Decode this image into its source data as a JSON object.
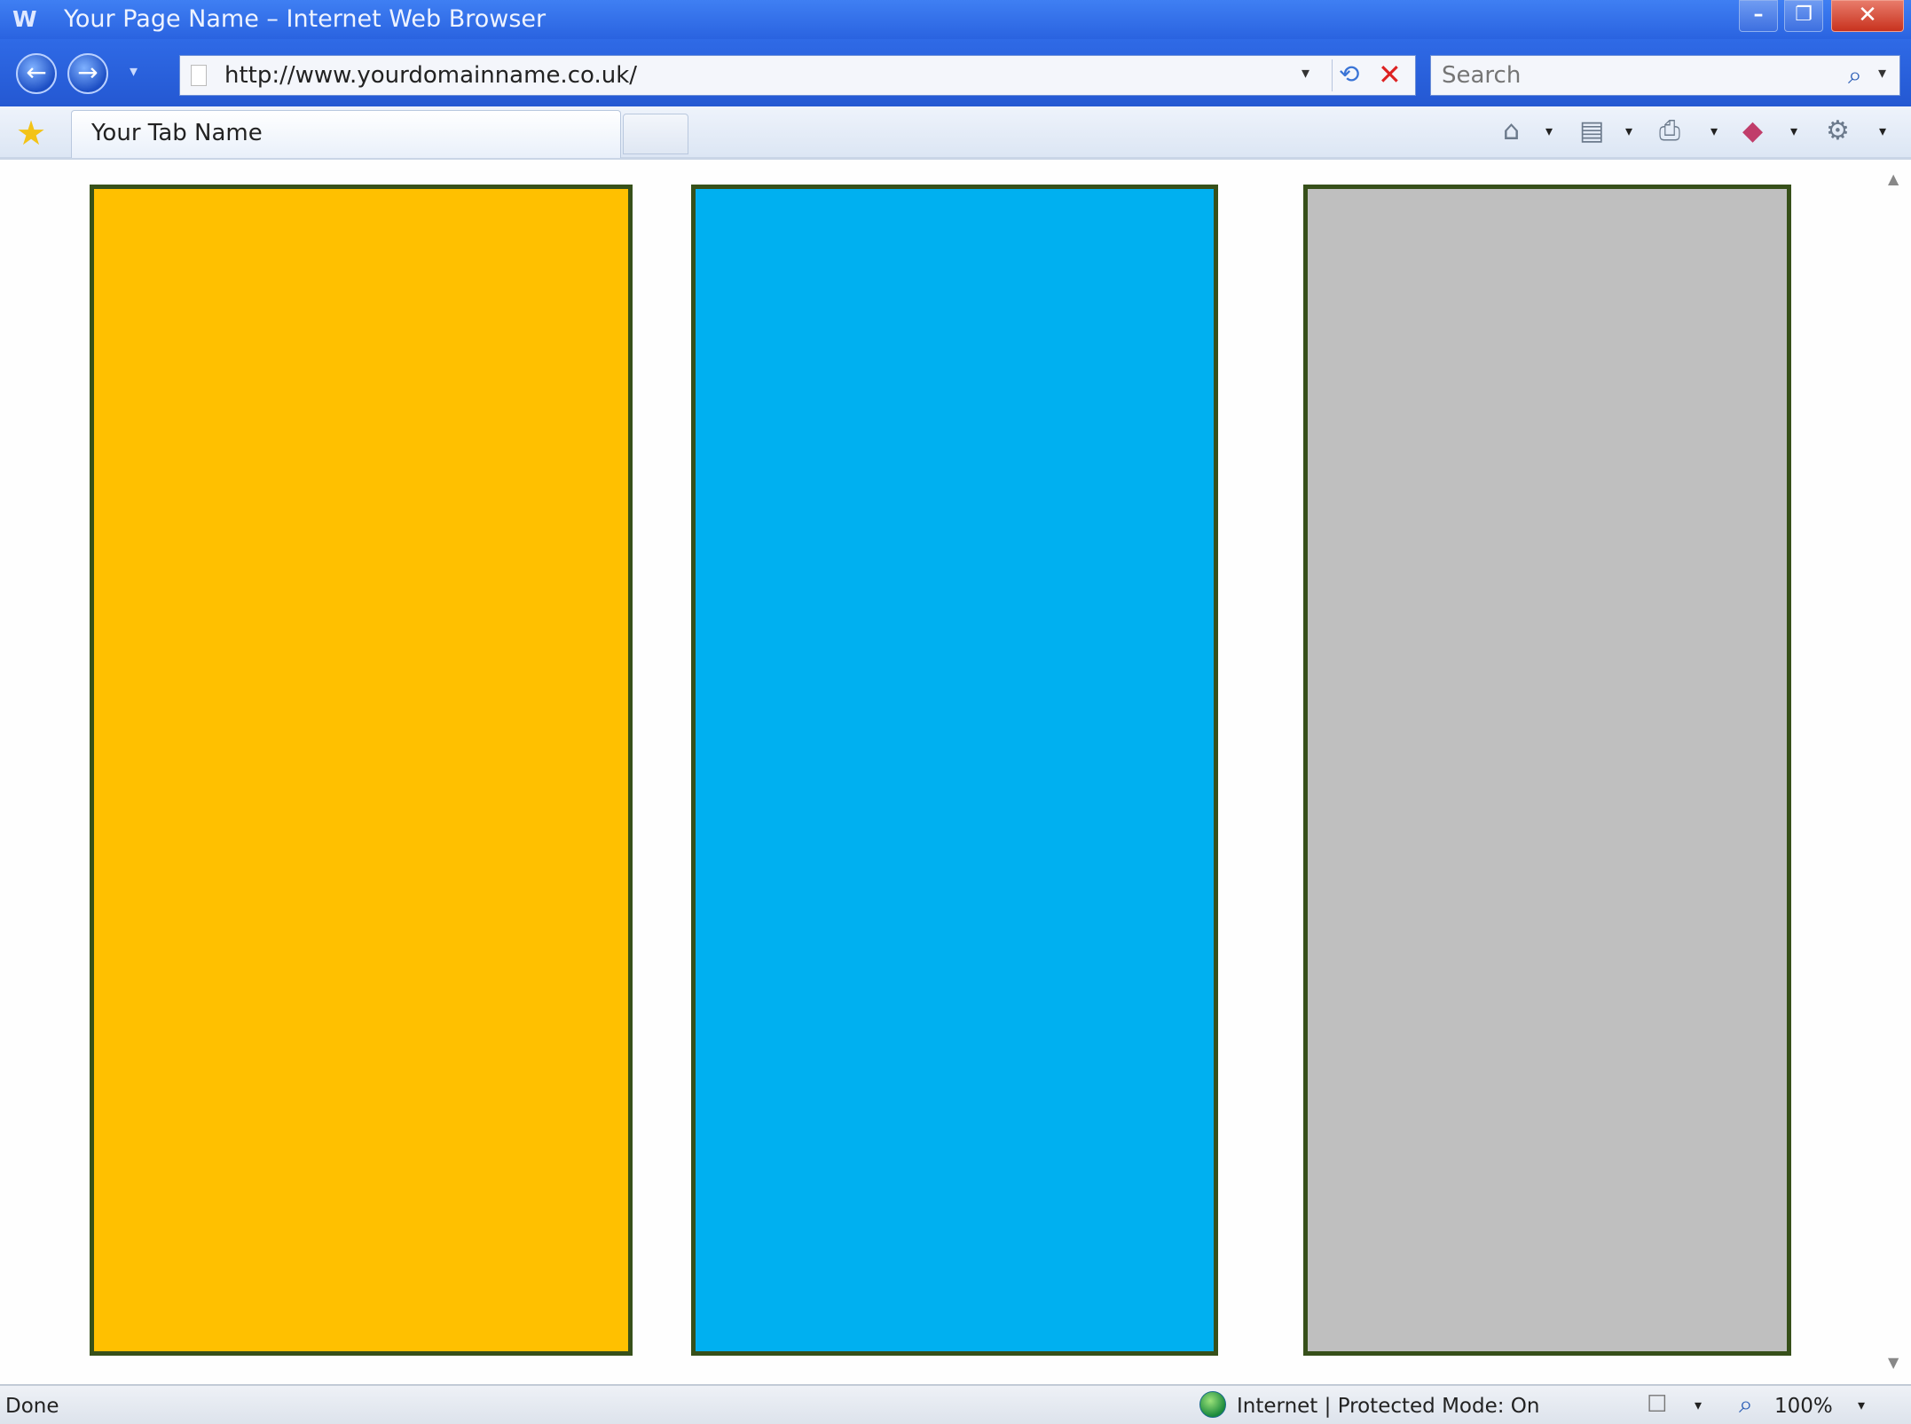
{
  "window": {
    "logo": "W",
    "title": "Your Page Name – Internet Web Browser",
    "min_glyph": "–",
    "max_glyph": "❐",
    "close_glyph": "✕"
  },
  "navigation": {
    "back_glyph": "←",
    "forward_glyph": "→",
    "dropdown_glyph": "▾"
  },
  "address_bar": {
    "url": "http://www.yourdomainname.co.uk/",
    "dropdown_glyph": "▾",
    "refresh_glyph": "⟲",
    "stop_glyph": "✕"
  },
  "search": {
    "placeholder": "Search",
    "icon_glyph": "⌕",
    "dropdown_glyph": "▾"
  },
  "tabs": {
    "favorites_glyph": "★",
    "active_tab_label": "Your Tab Name"
  },
  "commands": {
    "home_glyph": "⌂",
    "feeds_glyph": "▤",
    "print_glyph": "⎙",
    "page_glyph": "◆",
    "tools_glyph": "⚙",
    "dropdown_glyph": "▾"
  },
  "content": {
    "panels": [
      {
        "name": "orange-panel",
        "color": "#FFC000"
      },
      {
        "name": "blue-panel",
        "color": "#00B0F0"
      },
      {
        "name": "gray-panel",
        "color": "#BFBFBF"
      }
    ],
    "panel_border_color": "#37501A",
    "scroll_up_glyph": "▲",
    "scroll_down_glyph": "▼"
  },
  "status_bar": {
    "status": "Done",
    "zone": "Internet | Protected Mode: On",
    "lock_glyph": "☐",
    "zoom_glyph": "⌕",
    "zoom": "100%",
    "dropdown_glyph": "▾"
  }
}
